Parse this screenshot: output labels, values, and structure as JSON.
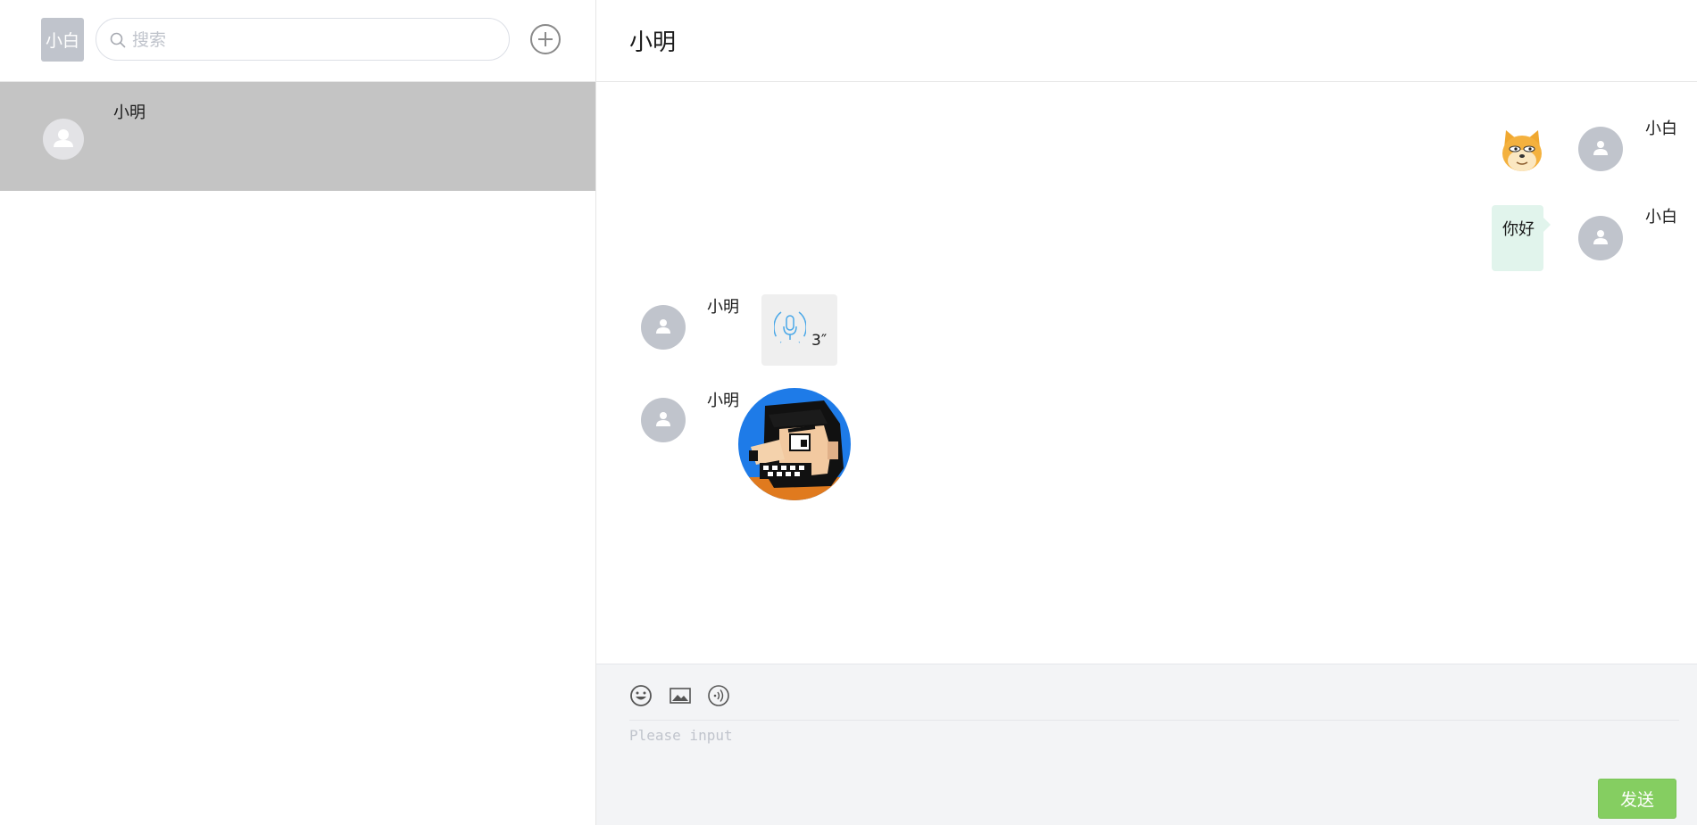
{
  "sidebar": {
    "self_avatar_text": "小白",
    "search": {
      "placeholder": "搜索",
      "value": ""
    },
    "contacts": [
      {
        "name": "小明",
        "selected": true
      }
    ]
  },
  "chat": {
    "title": "小明",
    "messages": [
      {
        "sender": "小白",
        "side": "right",
        "kind": "sticker",
        "content": "doge-sticker"
      },
      {
        "sender": "小白",
        "side": "right",
        "kind": "text",
        "content": "你好"
      },
      {
        "sender": "小明",
        "side": "left",
        "kind": "voice",
        "duration": "3″"
      },
      {
        "sender": "小明",
        "side": "left",
        "kind": "image",
        "content": "pixel-art-portrait"
      }
    ]
  },
  "composer": {
    "tools": [
      "emoji-icon",
      "image-icon",
      "voice-icon"
    ],
    "placeholder": "Please input",
    "value": "",
    "send_label": "发送"
  },
  "colors": {
    "selected_contact_bg": "#c4c4c4",
    "outgoing_bubble_bg": "#e1f4ec",
    "voice_bubble_bg": "#efefef",
    "send_button_bg": "#85ce61",
    "avatar_placeholder": "#c0c4cc",
    "composer_bg": "#f3f4f6"
  }
}
